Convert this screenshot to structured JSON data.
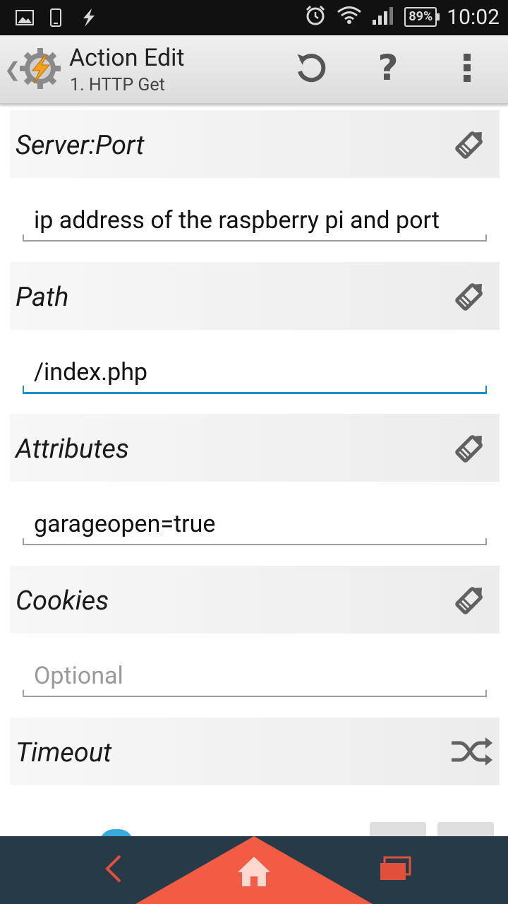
{
  "status_bar": {
    "battery": "89%",
    "time": "10:02"
  },
  "action_bar": {
    "title": "Action Edit",
    "subtitle": "1. HTTP Get"
  },
  "sections": [
    {
      "label": "Server:Port",
      "value": "ip address of the raspberry pi and port",
      "placeholder": ""
    },
    {
      "label": "Path",
      "value": "/index.php",
      "placeholder": ""
    },
    {
      "label": "Attributes",
      "value": "garageopen=true",
      "placeholder": ""
    },
    {
      "label": "Cookies",
      "value": "",
      "placeholder": "Optional"
    },
    {
      "label": "Timeout"
    }
  ],
  "colors": {
    "accent_input": "#1e90c8",
    "nav_bar": "#263b47",
    "nav_highlight": "#f25c45",
    "icon_grey": "#616161"
  },
  "icons": {
    "edit": "pencil-icon",
    "random": "shuffle-icon",
    "reset": "undo-icon",
    "help": "help-icon",
    "menu": "overflow-menu-icon"
  }
}
